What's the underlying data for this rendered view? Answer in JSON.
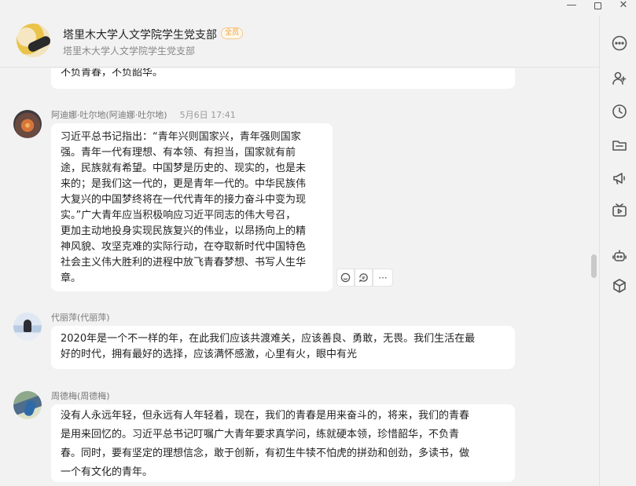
{
  "window": {
    "minimize": "—",
    "close": "✕"
  },
  "header": {
    "title": "塔里木大学人文学院学生党支部",
    "badge": "全员",
    "subtitle": "塔里木大学人文学院学生党支部"
  },
  "rail": {
    "icons": [
      "more-icon",
      "add-member-icon",
      "history-icon",
      "folder-icon",
      "announcement-icon",
      "video-icon",
      "robot-icon",
      "app-box-icon"
    ]
  },
  "messages": [
    {
      "id": "m0",
      "text": "不负青春，不负韶华。"
    },
    {
      "id": "m1",
      "sender": "阿迪娜·吐尔地(阿迪娜·吐尔地)",
      "time": "5月6日  17:41",
      "lines": [
        "习近平总书记指出：“青年兴则国家兴，青年强则国家",
        "强。青年一代有理想、有本领、有担当，国家就有前",
        "途，民族就有希望。中国梦是历史的、现实的，也是未",
        "来的；是我们这一代的，更是青年一代的。中华民族伟",
        "大复兴的中国梦终将在一代代青年的接力奋斗中变为现",
        "实。”广大青年应当积极响应习近平同志的伟大号召，",
        "更加主动地投身实现民族复兴的伟业，以昂扬向上的精",
        "神风貌、攻坚克难的实际行动，在夺取新时代中国特色",
        "社会主义伟大胜利的进程中放飞青春梦想、书写人生华",
        "章。"
      ]
    },
    {
      "id": "m2",
      "sender": "代丽萍(代丽萍)",
      "lines": [
        "2020年是一个不一样的年，在此我们应该共渡难关，应该善良、勇敢，无畏。我们生活在最",
        "好的时代，拥有最好的选择，应该满怀感激，心里有火，眼中有光"
      ]
    },
    {
      "id": "m3",
      "sender": "周德梅(周德梅)",
      "lines": [
        "没有人永远年轻，但永远有人年轻着，现在，我们的青春是用来奋斗的，将来，我们的青春",
        "是用来回忆的。习近平总书记叮嘱广大青年要求真学问，练就硬本领，珍惜韶华，不负青",
        "春。同时，要有坚定的理想信念，敢于创新，有初生牛犊不怕虎的拼劲和创劲，多读书，做",
        "一个有文化的青年。"
      ]
    }
  ],
  "actions": {
    "more": "···"
  }
}
